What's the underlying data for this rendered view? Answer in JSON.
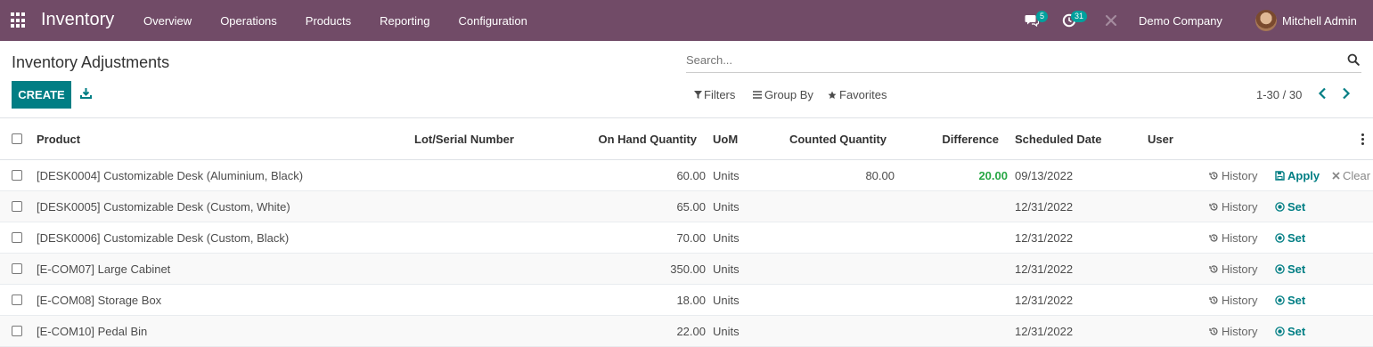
{
  "app": {
    "title": "Inventory"
  },
  "nav": {
    "menu": [
      "Overview",
      "Operations",
      "Products",
      "Reporting",
      "Configuration"
    ]
  },
  "systray": {
    "messages_count": "5",
    "activities_count": "31",
    "company": "Demo Company",
    "user": "Mitchell Admin"
  },
  "page": {
    "title": "Inventory Adjustments"
  },
  "search": {
    "placeholder": "Search..."
  },
  "toolbar": {
    "create_label": "CREATE",
    "filters_label": "Filters",
    "group_by_label": "Group By",
    "favorites_label": "Favorites"
  },
  "pager": {
    "value": "1-30 / 30"
  },
  "colors": {
    "brand": "#714b67",
    "primary": "#017e84",
    "positive": "#28a745",
    "badge": "#00a09d"
  },
  "table": {
    "columns": {
      "product": "Product",
      "lot": "Lot/Serial Number",
      "on_hand": "On Hand Quantity",
      "uom": "UoM",
      "counted": "Counted Quantity",
      "difference": "Difference",
      "scheduled": "Scheduled Date",
      "user": "User"
    },
    "actions": {
      "history": "History",
      "apply": "Apply",
      "clear": "Clear",
      "set": "Set"
    },
    "rows": [
      {
        "product": "[DESK0004] Customizable Desk (Aluminium, Black)",
        "on_hand": "60.00",
        "uom": "Units",
        "counted": "80.00",
        "difference": "20.00",
        "date": "09/13/2022"
      },
      {
        "product": "[DESK0005] Customizable Desk (Custom, White)",
        "on_hand": "65.00",
        "uom": "Units",
        "counted": "",
        "difference": "",
        "date": "12/31/2022"
      },
      {
        "product": "[DESK0006] Customizable Desk (Custom, Black)",
        "on_hand": "70.00",
        "uom": "Units",
        "counted": "",
        "difference": "",
        "date": "12/31/2022"
      },
      {
        "product": "[E-COM07] Large Cabinet",
        "on_hand": "350.00",
        "uom": "Units",
        "counted": "",
        "difference": "",
        "date": "12/31/2022"
      },
      {
        "product": "[E-COM08] Storage Box",
        "on_hand": "18.00",
        "uom": "Units",
        "counted": "",
        "difference": "",
        "date": "12/31/2022"
      },
      {
        "product": "[E-COM10] Pedal Bin",
        "on_hand": "22.00",
        "uom": "Units",
        "counted": "",
        "difference": "",
        "date": "12/31/2022"
      }
    ]
  }
}
